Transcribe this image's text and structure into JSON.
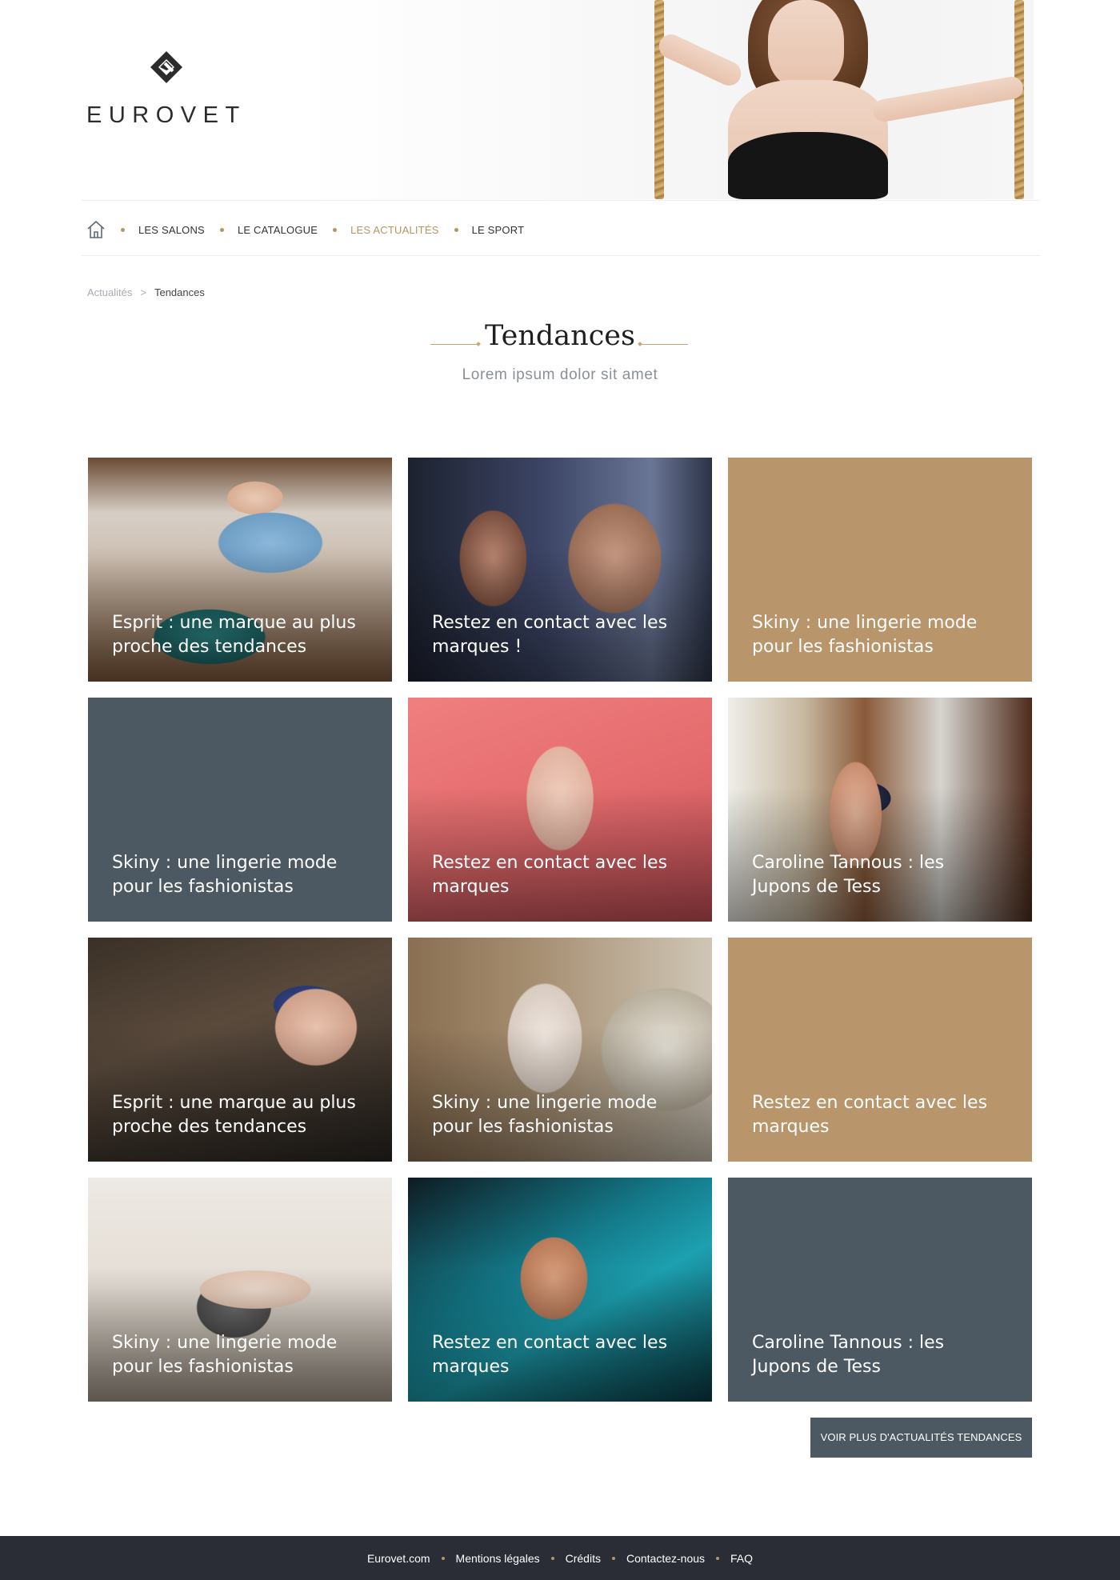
{
  "brand": {
    "name": "EUROVET",
    "accent": "#b8955f",
    "slate": "#4c5862",
    "gold_tile": "#b8956a"
  },
  "nav": {
    "home_icon": "home-icon",
    "items": [
      {
        "label": "LES SALONS",
        "active": false
      },
      {
        "label": "LE CATALOGUE",
        "active": false
      },
      {
        "label": "LES ACTUALITÉS",
        "active": true
      },
      {
        "label": "LE SPORT",
        "active": false
      }
    ]
  },
  "breadcrumb": {
    "parent": "Actualités",
    "separator": ">",
    "current": "Tendances"
  },
  "page": {
    "title": "Tendances",
    "subtitle": "Lorem ipsum dolor sit amet"
  },
  "cards": [
    {
      "title": "Esprit : une marque au plus proche des tendances"
    },
    {
      "title": "Restez en contact avec les marques !"
    },
    {
      "title": "Skiny : une lingerie mode pour les fashionistas"
    },
    {
      "title": "Skiny : une lingerie mode pour les fashionistas"
    },
    {
      "title": "Restez en contact avec les marques"
    },
    {
      "title": "Caroline Tannous : les Jupons de Tess"
    },
    {
      "title": "Esprit : une marque au plus proche des tendances"
    },
    {
      "title": "Skiny : une lingerie mode pour les fashionistas"
    },
    {
      "title": "Restez en contact avec les marques"
    },
    {
      "title": "Skiny : une lingerie mode pour les fashionistas"
    },
    {
      "title": "Restez en contact avec les marques"
    },
    {
      "title": "Caroline Tannous : les Jupons de Tess"
    }
  ],
  "more_button": {
    "label": "VOIR PLUS D'ACTUALITÉS TENDANCES"
  },
  "footer": {
    "links": [
      "Eurovet.com",
      "Mentions légales",
      "Crédits",
      "Contactez-nous",
      "FAQ"
    ]
  }
}
